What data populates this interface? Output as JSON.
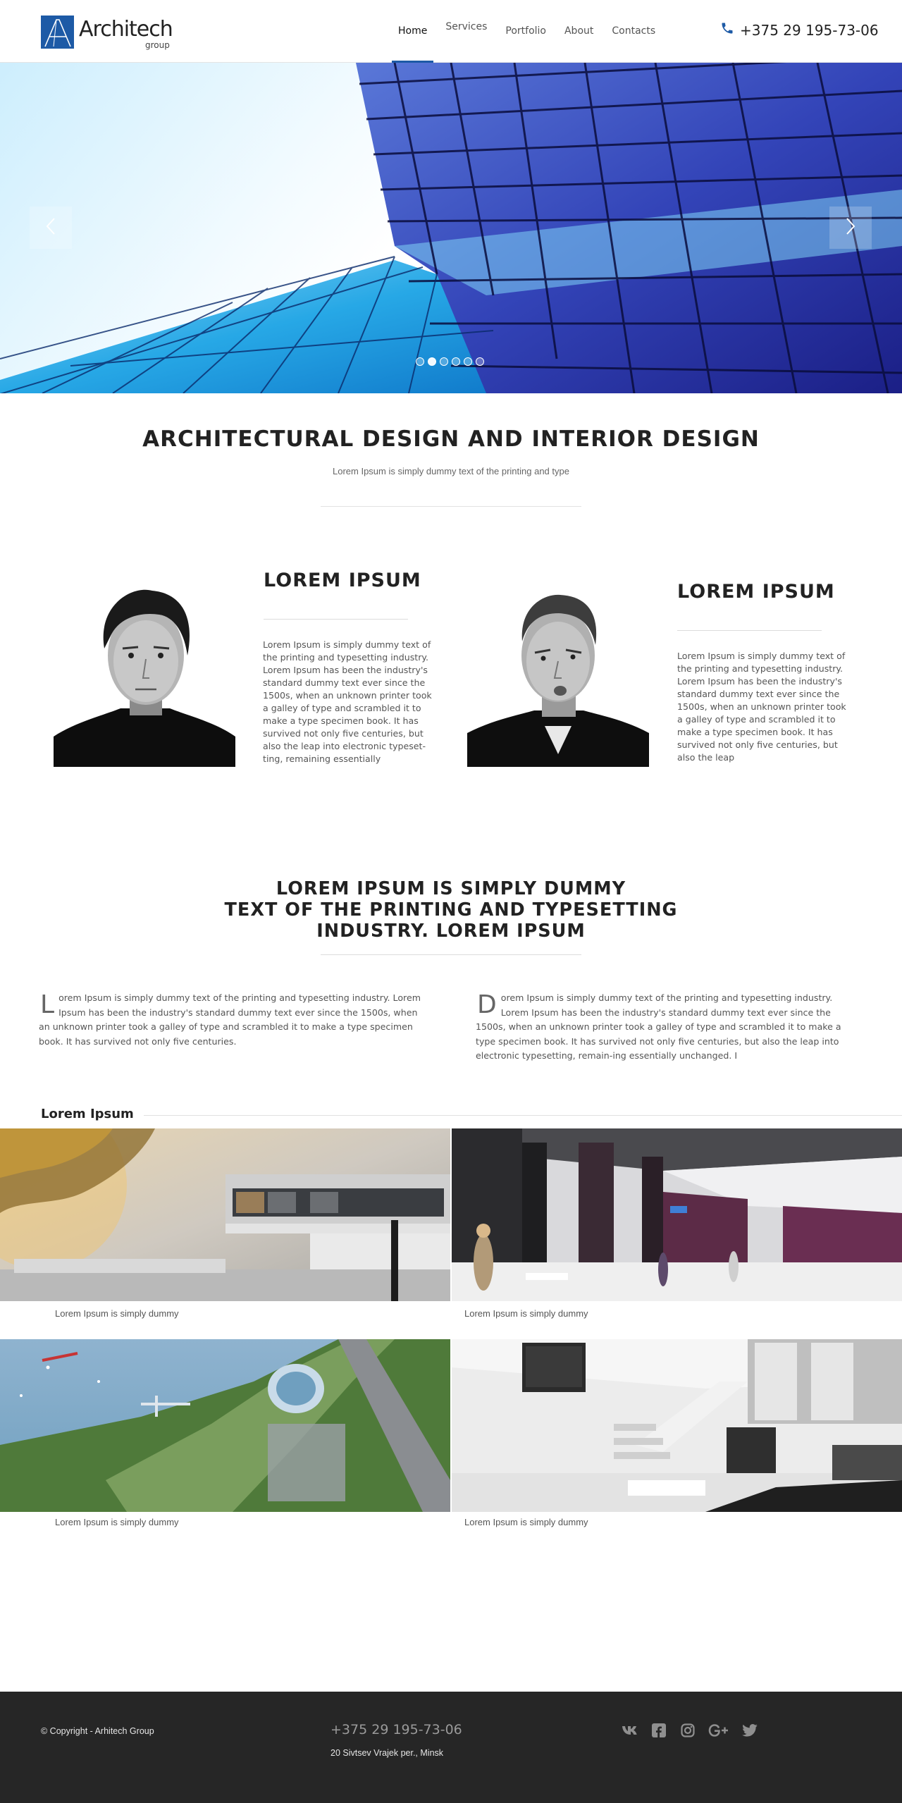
{
  "header": {
    "logo_text": "Architech",
    "logo_sub": "group",
    "nav": [
      {
        "label": "Home",
        "active": true
      },
      {
        "label": "Services",
        "active": false
      },
      {
        "label": "Portfolio",
        "active": false
      },
      {
        "label": "About",
        "active": false
      },
      {
        "label": "Contacts",
        "active": false
      }
    ],
    "phone": "+375 29 195-73-06"
  },
  "slider": {
    "prev_icon": "chevron-left-icon",
    "next_icon": "chevron-right-icon",
    "dots": 6,
    "active_dot": 2
  },
  "intro": {
    "title": "ARCHITECTURAL DESIGN AND INTERIOR DESIGN",
    "subtitle": "Lorem Ipsum is simply dummy text of the printing and type"
  },
  "people": [
    {
      "title": "LOREM IPSUM",
      "text": "Lorem Ipsum is simply dummy text of the printing and typesetting industry. Lorem Ipsum has been the industry's standard dummy text ever since the 1500s, when an unknown printer took a galley of type and scrambled it to make a type specimen book. It has survived not only five centuries, but also the leap into electronic typeset-ting, remaining essentially"
    },
    {
      "title": "LOREM IPSUM",
      "text": "Lorem Ipsum is simply dummy text of the printing and typesetting industry. Lorem Ipsum has been the industry's standard dummy text ever since the 1500s, when an unknown printer took a galley of type and scrambled it to make a type specimen book. It has survived not only five centuries, but also the leap"
    }
  ],
  "quote": {
    "line1": "LOREM IPSUM IS SIMPLY DUMMY",
    "line2": "TEXT OF THE PRINTING AND TYPESETTING",
    "line3": "INDUSTRY. LOREM IPSUM"
  },
  "columns": [
    {
      "dropcap": "L",
      "text": "orem Ipsum is simply dummy text of the printing and typesetting industry. Lorem Ipsum has been the industry's standard dummy text ever since the 1500s, when an unknown printer took a galley of type and scrambled it to make a type specimen book. It has survived not only five centuries."
    },
    {
      "dropcap": "D",
      "text": "orem Ipsum is simply dummy text of the printing and typesetting industry. Lorem Ipsum has been the industry's standard dummy text ever since the 1500s, when an unknown printer took a galley of type and scrambled it to make a type specimen book. It has survived not only five centuries, but also the leap into electronic typesetting, remain-ing essentially unchanged. I"
    }
  ],
  "gallery": {
    "title": "Lorem Ipsum",
    "items": [
      {
        "caption": "Lorem Ipsum is simply dummy"
      },
      {
        "caption": "Lorem Ipsum is simply dummy"
      },
      {
        "caption": "Lorem Ipsum is simply dummy"
      },
      {
        "caption": "Lorem Ipsum is simply dummy"
      }
    ]
  },
  "footer": {
    "copyright": "© Copyright - Arhitech Group",
    "phone": "+375 29 195-73-06",
    "address": "20 Sivtsev Vrajek per., Minsk",
    "socials": [
      "vk-icon",
      "facebook-icon",
      "instagram-icon",
      "google-plus-icon",
      "twitter-icon"
    ]
  },
  "colors": {
    "accent": "#1d5aa6",
    "footer_bg": "#262626",
    "text": "#555555"
  }
}
